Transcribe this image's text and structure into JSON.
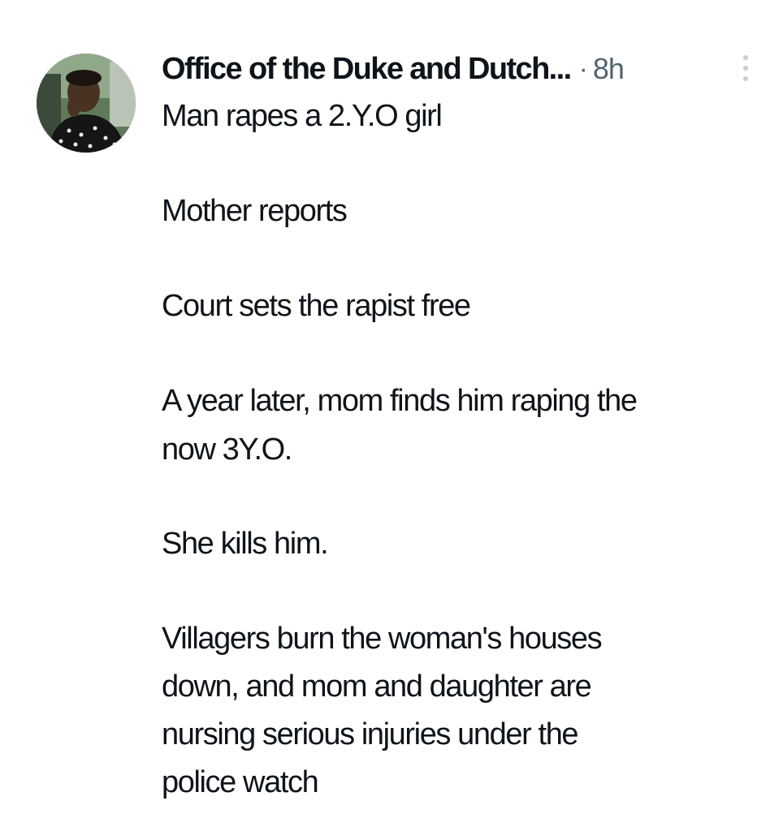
{
  "tweet": {
    "author": "Office of the Duke and Dutch...",
    "separator": "·",
    "time": "8h",
    "lines": [
      "Man rapes a 2.Y.O girl",
      "Mother reports",
      "Court sets the rapist free",
      "A year later, mom finds him raping the",
      "now 3Y.O.",
      "She kills him.",
      "Villagers burn the woman's houses",
      "down, and mom and daughter are",
      "nursing serious injuries under the",
      "police watch"
    ]
  },
  "icons": {
    "avatar": "avatar-photo",
    "more": "more-vertical-icon"
  },
  "colors": {
    "text": "#0f1419",
    "muted": "#536471",
    "more_dots": "#c9ced3"
  }
}
